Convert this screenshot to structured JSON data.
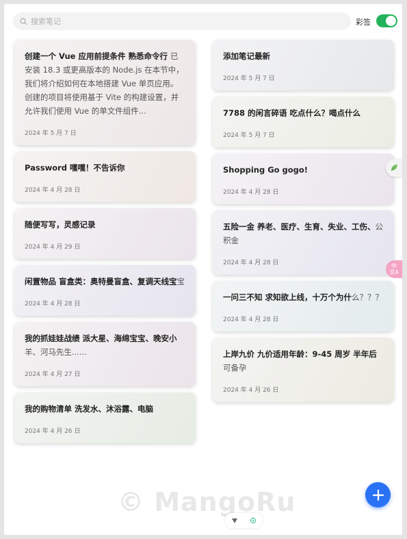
{
  "search": {
    "placeholder": "搜索笔记"
  },
  "toggle": {
    "label": "彩签",
    "on": true
  },
  "left_notes": [
    {
      "title": "创建一个 Vue 应用前提条件 熟悉命令行",
      "body": "已安装 18.3 或更高版本的 Node.js 在本节中，我们将介绍如何在本地搭建 Vue 单页应用。创建的项目将使用基于 Vite 的构建设置，并允许我们使用 Vue 的单文件组件...",
      "date": "2024 年 5 月 7 日"
    },
    {
      "title": "Password 嘿嘿！不告诉你",
      "body": "",
      "date": "2024 年 4 月 28 日"
    },
    {
      "title": "随便写写，灵感记录",
      "body": "",
      "date": "2024 年 4 月 29 日"
    },
    {
      "title": "闲置物品 盲盒类：奥特曼盲盒、复调天线宝",
      "body": "宝",
      "date": "2024 年 4 月 28 日"
    },
    {
      "title": "我的抓娃娃战绩 派大星、海绵宝宝、晚安小",
      "body": "羊、河马先生......",
      "date": "2024 年 4 月 27 日"
    },
    {
      "title": "我的购物清单 洗发水、沐浴露、电脑",
      "body": "",
      "date": "2024 年 4 月 26 日"
    }
  ],
  "right_notes": [
    {
      "title": "添加笔记最新",
      "body": "",
      "date": "2024 年 5 月 7 日"
    },
    {
      "title": "7788 的闲言碎语 吃点什么？喝点什么",
      "body": "",
      "date": "2024 年 5 月 7 日"
    },
    {
      "title": "Shopping Go gogo!",
      "body": "",
      "date": "2024 年 4 月 28 日"
    },
    {
      "title": "五险一金 养老、医疗、生育、失业、工伤、",
      "body": "公积金",
      "date": "2024 年 4 月 28 日"
    },
    {
      "title": "一问三不知 求知欲上线，十万个为什",
      "body": "么？？？",
      "date": "2024 年 4 月 28 日"
    },
    {
      "title": "上岸九价 九价适用年龄：9-45 周岁 半年后",
      "body": "可备孕",
      "date": "2024 年 4 月 26 日"
    }
  ],
  "side_tabs": {
    "translate_label": "中文A"
  },
  "watermark": "© MangoRu",
  "colors": {
    "accent": "#2a72f5",
    "toggle_on": "#24b35a"
  }
}
